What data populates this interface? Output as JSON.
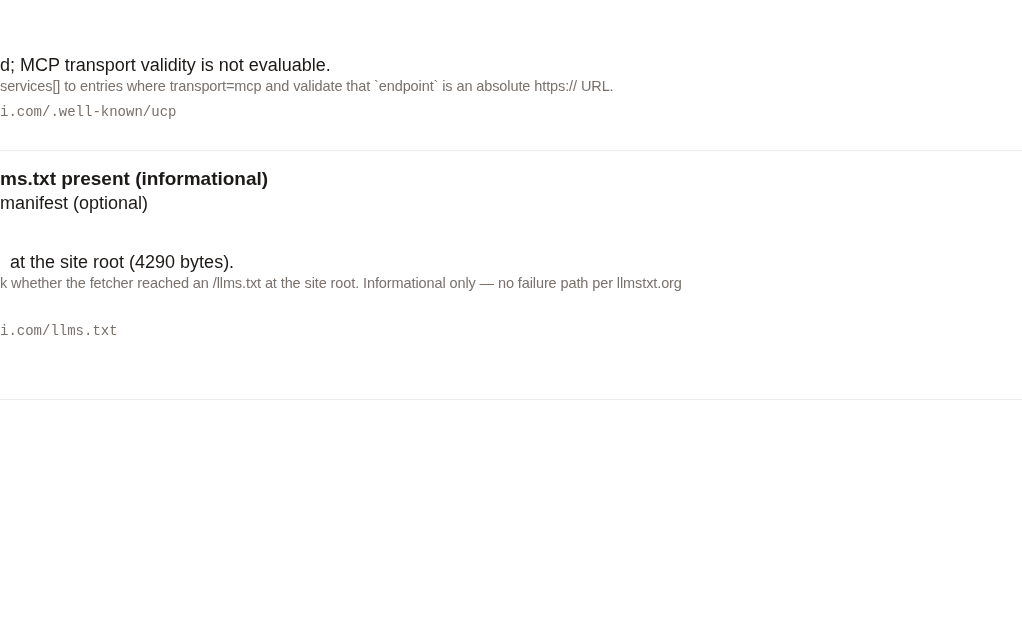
{
  "checks": [
    {
      "result": "d; MCP transport validity is not evaluable.",
      "explanation": "services[] to entries where transport=mcp and validate that `endpoint` is an absolute https:// URL.",
      "url": "i.com/.well-known/ucp"
    },
    {
      "title": "ms.txt present (informational)",
      "subtitle": "manifest (optional)",
      "result": "at the site root (4290 bytes).",
      "explanation": "k whether the fetcher reached an /llms.txt at the site root. Informational only — no failure path per llmstxt.org",
      "url": "i.com/llms.txt"
    }
  ]
}
